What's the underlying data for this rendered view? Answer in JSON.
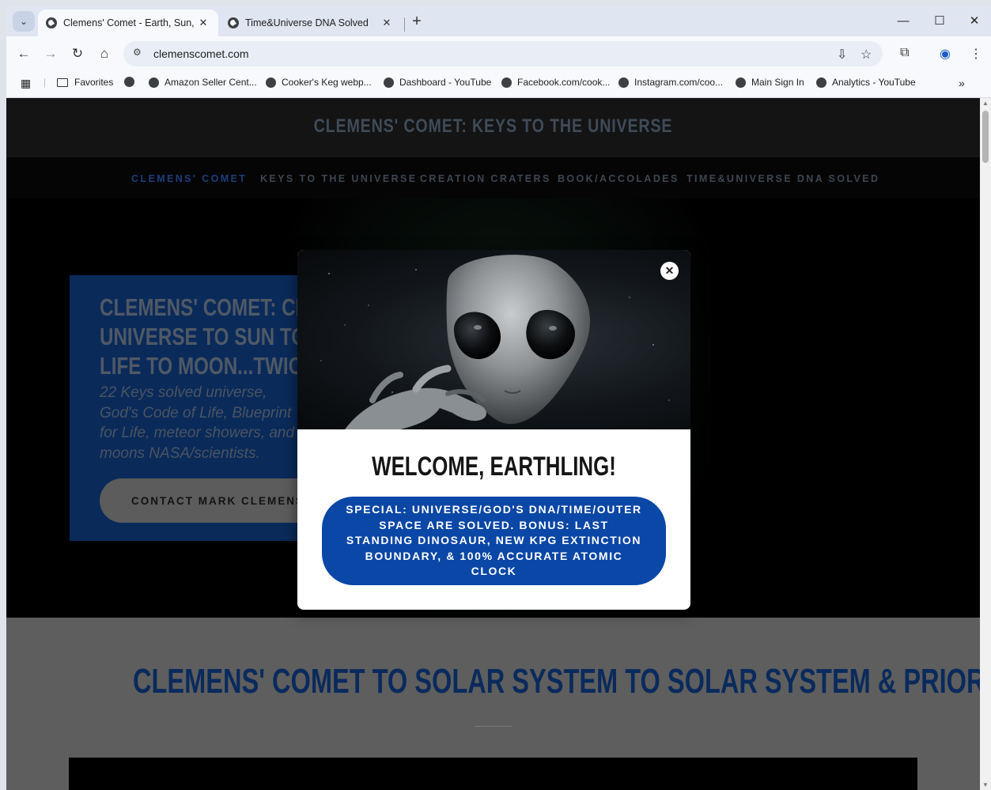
{
  "browser": {
    "tabs": [
      {
        "title": "Clemens' Comet - Earth, Sun, Ea",
        "active": true
      },
      {
        "title": "Time&Universe DNA Solved",
        "active": false
      }
    ],
    "url": "clemenscomet.com",
    "bookmarks": [
      {
        "label": "Favorites",
        "icon": "folder-icon"
      },
      {
        "label": "",
        "icon": "globe-icon"
      },
      {
        "label": "Amazon Seller Cent...",
        "icon": "globe-icon"
      },
      {
        "label": "Cooker's Keg webp...",
        "icon": "globe-icon"
      },
      {
        "label": "Dashboard - YouTube",
        "icon": "globe-icon"
      },
      {
        "label": "Facebook.com/cook...",
        "icon": "globe-icon"
      },
      {
        "label": "Instagram.com/coo...",
        "icon": "globe-icon"
      },
      {
        "label": "Main Sign In",
        "icon": "globe-icon"
      },
      {
        "label": "Analytics - YouTube",
        "icon": "globe-icon"
      }
    ]
  },
  "site": {
    "title": "CLEMENS' COMET: KEYS TO THE UNIVERSE",
    "nav": [
      {
        "label": "CLEMENS' COMET",
        "current": true
      },
      {
        "label": "KEYS TO THE UNIVERSE",
        "current": false
      },
      {
        "label": "CREATION CRATERS",
        "current": false
      },
      {
        "label": "BOOK/ACCOLADES",
        "current": false
      },
      {
        "label": "TIME&UNIVERSE DNA SOLVED",
        "current": false
      }
    ],
    "hero": {
      "heading": "CLEMENS' COMET: CREATED UNIVERSE TO SUN TO EARTH, LIFE TO MOON...TWICE!",
      "text": "22 Keys solved universe, God's Code of Life, Blueprint for Life, meteor showers, and moons NASA/scientists.",
      "button": "CONTACT MARK CLEMENS"
    },
    "section_title": "CLEMENS' COMET TO SOLAR SYSTEM TO SOLAR SYSTEM & PRIOR"
  },
  "modal": {
    "heading": "WELCOME, EARTHLING!",
    "cta": "SPECIAL: UNIVERSE/GOD'S DNA/TIME/OUTER SPACE ARE SOLVED. BONUS: LAST STANDING DINOSAUR, NEW KPG EXTINCTION BOUNDARY, & 100% ACCURATE ATOMIC CLOCK",
    "close": "✕"
  },
  "colors": {
    "modal_cta": "#0a47a6",
    "nav_current": "#1c3d7c",
    "section_title": "#0a2a5c"
  }
}
